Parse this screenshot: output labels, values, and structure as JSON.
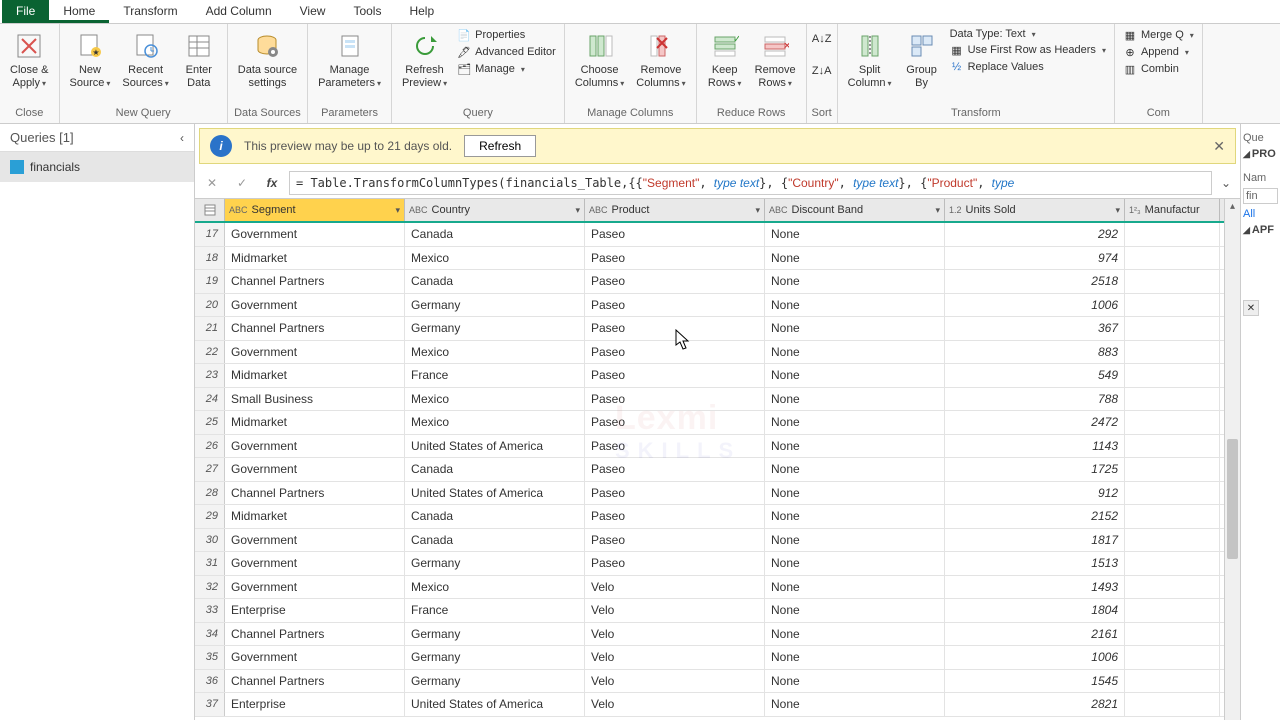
{
  "tabs": {
    "file": "File",
    "home": "Home",
    "transform": "Transform",
    "addcol": "Add Column",
    "view": "View",
    "tools": "Tools",
    "help": "Help"
  },
  "ribbon": {
    "close": {
      "btn": "Close &\nApply",
      "group": "Close"
    },
    "newquery": {
      "new": "New\nSource",
      "recent": "Recent\nSources",
      "enter": "Enter\nData",
      "group": "New Query"
    },
    "datasources": {
      "settings": "Data source\nsettings",
      "group": "Data Sources"
    },
    "parameters": {
      "manage": "Manage\nParameters",
      "group": "Parameters"
    },
    "query": {
      "refresh": "Refresh\nPreview",
      "properties": "Properties",
      "advanced": "Advanced Editor",
      "manage": "Manage",
      "group": "Query"
    },
    "managecols": {
      "choose": "Choose\nColumns",
      "remove": "Remove\nColumns",
      "group": "Manage Columns"
    },
    "reducerows": {
      "keep": "Keep\nRows",
      "remove": "Remove\nRows",
      "group": "Reduce Rows"
    },
    "sort": {
      "group": "Sort"
    },
    "transform": {
      "split": "Split\nColumn",
      "group_btn": "Group\nBy",
      "datatype_label": "Data Type: Text",
      "headers": "Use First Row as Headers",
      "replace": "Replace Values",
      "group": "Transform"
    },
    "combine": {
      "merge": "Merge Q",
      "append": "Append",
      "combine": "Combin",
      "group": "Com"
    }
  },
  "queries": {
    "title": "Queries [1]",
    "item1": "financials"
  },
  "notice": {
    "text": "This preview may be up to 21 days old.",
    "refresh": "Refresh"
  },
  "formula": "= Table.TransformColumnTypes(financials_Table,{{\"Segment\", type text}, {\"Country\", type text}, {\"Product\", type",
  "columns": [
    "Segment",
    "Country",
    "Product",
    "Discount Band",
    "Units Sold",
    "Manufactur"
  ],
  "col_types": [
    "ABC",
    "ABC",
    "ABC",
    "ABC",
    "1.2",
    "1²₃"
  ],
  "rows": [
    {
      "n": 17,
      "seg": "Government",
      "cty": "Canada",
      "prd": "Paseo",
      "disc": "None",
      "units": "292"
    },
    {
      "n": 18,
      "seg": "Midmarket",
      "cty": "Mexico",
      "prd": "Paseo",
      "disc": "None",
      "units": "974"
    },
    {
      "n": 19,
      "seg": "Channel Partners",
      "cty": "Canada",
      "prd": "Paseo",
      "disc": "None",
      "units": "2518"
    },
    {
      "n": 20,
      "seg": "Government",
      "cty": "Germany",
      "prd": "Paseo",
      "disc": "None",
      "units": "1006"
    },
    {
      "n": 21,
      "seg": "Channel Partners",
      "cty": "Germany",
      "prd": "Paseo",
      "disc": "None",
      "units": "367"
    },
    {
      "n": 22,
      "seg": "Government",
      "cty": "Mexico",
      "prd": "Paseo",
      "disc": "None",
      "units": "883"
    },
    {
      "n": 23,
      "seg": "Midmarket",
      "cty": "France",
      "prd": "Paseo",
      "disc": "None",
      "units": "549"
    },
    {
      "n": 24,
      "seg": "Small Business",
      "cty": "Mexico",
      "prd": "Paseo",
      "disc": "None",
      "units": "788"
    },
    {
      "n": 25,
      "seg": "Midmarket",
      "cty": "Mexico",
      "prd": "Paseo",
      "disc": "None",
      "units": "2472"
    },
    {
      "n": 26,
      "seg": "Government",
      "cty": "United States of America",
      "prd": "Paseo",
      "disc": "None",
      "units": "1143"
    },
    {
      "n": 27,
      "seg": "Government",
      "cty": "Canada",
      "prd": "Paseo",
      "disc": "None",
      "units": "1725"
    },
    {
      "n": 28,
      "seg": "Channel Partners",
      "cty": "United States of America",
      "prd": "Paseo",
      "disc": "None",
      "units": "912"
    },
    {
      "n": 29,
      "seg": "Midmarket",
      "cty": "Canada",
      "prd": "Paseo",
      "disc": "None",
      "units": "2152"
    },
    {
      "n": 30,
      "seg": "Government",
      "cty": "Canada",
      "prd": "Paseo",
      "disc": "None",
      "units": "1817"
    },
    {
      "n": 31,
      "seg": "Government",
      "cty": "Germany",
      "prd": "Paseo",
      "disc": "None",
      "units": "1513"
    },
    {
      "n": 32,
      "seg": "Government",
      "cty": "Mexico",
      "prd": "Velo",
      "disc": "None",
      "units": "1493"
    },
    {
      "n": 33,
      "seg": "Enterprise",
      "cty": "France",
      "prd": "Velo",
      "disc": "None",
      "units": "1804"
    },
    {
      "n": 34,
      "seg": "Channel Partners",
      "cty": "Germany",
      "prd": "Velo",
      "disc": "None",
      "units": "2161"
    },
    {
      "n": 35,
      "seg": "Government",
      "cty": "Germany",
      "prd": "Velo",
      "disc": "None",
      "units": "1006"
    },
    {
      "n": 36,
      "seg": "Channel Partners",
      "cty": "Germany",
      "prd": "Velo",
      "disc": "None",
      "units": "1545"
    },
    {
      "n": 37,
      "seg": "Enterprise",
      "cty": "United States of America",
      "prd": "Velo",
      "disc": "None",
      "units": "2821"
    }
  ],
  "right": {
    "que": "Que",
    "pro": "PRO",
    "name": "Nam",
    "fin": "fin",
    "all": "All",
    "apf": "APF"
  }
}
